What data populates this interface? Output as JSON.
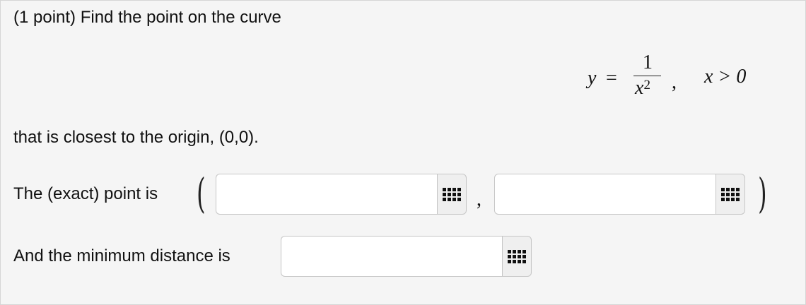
{
  "problem": {
    "intro": "(1 point) Find the point on the curve",
    "statement": "that is closest to the origin, (0,0).",
    "equation": {
      "lhs": "y",
      "equals": "=",
      "numerator": "1",
      "denominator_base": "x",
      "denominator_exp": "2",
      "separator": ",",
      "condition": "x > 0"
    }
  },
  "point_answer": {
    "label": "The (exact) point is",
    "open_paren": "(",
    "close_paren": ")",
    "comma": ",",
    "x_value": "",
    "y_value": "",
    "x_palette_icon": "grid-icon",
    "y_palette_icon": "grid-icon"
  },
  "distance_answer": {
    "label": "And the minimum distance is",
    "value": "",
    "palette_icon": "grid-icon"
  }
}
